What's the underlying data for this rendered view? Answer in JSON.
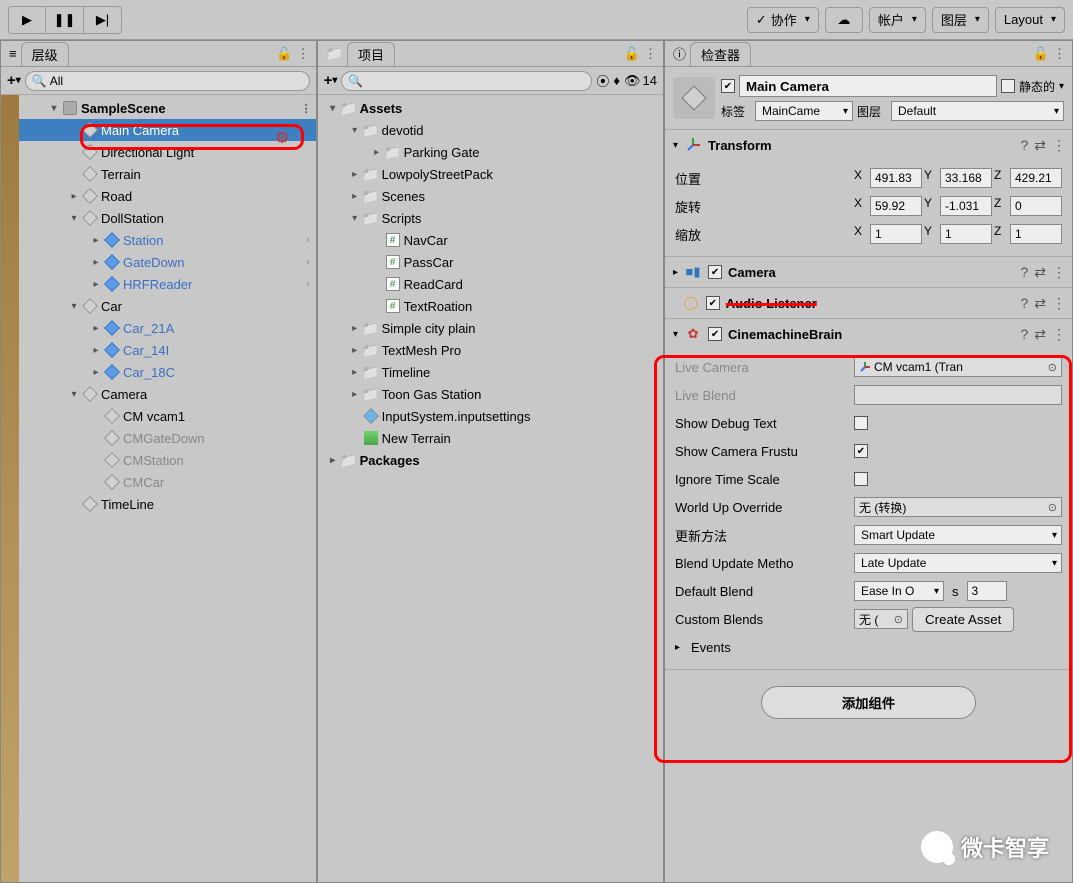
{
  "toolbar": {
    "collab": "协作",
    "account": "帐户",
    "layers": "图层",
    "layout": "Layout"
  },
  "hierarchy": {
    "tab": "层级",
    "search": "All",
    "scene": "SampleScene",
    "items": {
      "main_camera": "Main Camera",
      "directional_light": "Directional Light",
      "terrain": "Terrain",
      "road": "Road",
      "dollstation": "DollStation",
      "station": "Station",
      "gatedown": "GateDown",
      "hrfreader": "HRFReader",
      "car": "Car",
      "car21a": "Car_21A",
      "car14i": "Car_14I",
      "car18c": "Car_18C",
      "camera": "Camera",
      "cmvcam1": "CM vcam1",
      "cmgatedown": "CMGateDown",
      "cmstation": "CMStation",
      "cmcar": "CMCar",
      "timeline": "TimeLine"
    }
  },
  "project": {
    "tab": "项目",
    "hidden_count": "14",
    "root_assets": "Assets",
    "folders": {
      "devotid": "devotid",
      "parking_gate": "Parking Gate",
      "lowpoly": "LowpolyStreetPack",
      "scenes": "Scenes",
      "scripts": "Scripts",
      "navcar": "NavCar",
      "passcar": "PassCar",
      "readcard": "ReadCard",
      "textrotation": "TextRoation",
      "simplecity": "Simple city plain",
      "tmpro": "TextMesh Pro",
      "timeline": "Timeline",
      "toongas": "Toon Gas Station",
      "inputsystem": "InputSystem.inputsettings",
      "newterrain": "New Terrain",
      "packages": "Packages"
    }
  },
  "inspector": {
    "tab": "检查器",
    "object_name": "Main Camera",
    "static": "静态的",
    "tag_label": "标签",
    "tag_value": "MainCame",
    "layer_label": "图层",
    "layer_value": "Default",
    "transform": {
      "title": "Transform",
      "pos_label": "位置",
      "rot_label": "旋转",
      "scale_label": "缩放",
      "px": "491.83",
      "py": "33.168",
      "pz": "429.21",
      "rx": "59.92",
      "ry": "-1.031",
      "rz": "0",
      "sx": "1",
      "sy": "1",
      "sz": "1"
    },
    "camera": {
      "title": "Camera"
    },
    "audio": {
      "title": "Audio Listener"
    },
    "cinemachine": {
      "title": "CinemachineBrain",
      "live_camera": "Live Camera",
      "live_camera_val": "CM vcam1 (Tran",
      "live_blend": "Live Blend",
      "show_debug": "Show Debug Text",
      "show_frustum": "Show Camera Frustu",
      "ignore_time": "Ignore Time Scale",
      "world_up": "World Up Override",
      "world_up_val": "无 (转换)",
      "update_method": "更新方法",
      "update_method_val": "Smart Update",
      "blend_update": "Blend Update Metho",
      "blend_update_val": "Late Update",
      "default_blend": "Default Blend",
      "default_blend_val": "Ease In O",
      "default_blend_s": "s",
      "default_blend_num": "3",
      "custom_blends": "Custom Blends",
      "custom_blends_val": "无 (",
      "create_asset": "Create Asset",
      "events": "Events"
    },
    "add_component": "添加组件"
  },
  "watermark": "微卡智享"
}
